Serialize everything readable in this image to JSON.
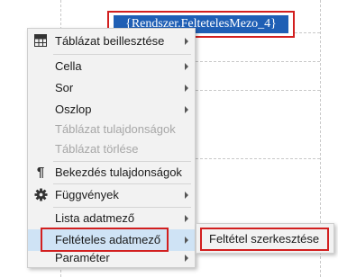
{
  "document": {
    "field_text": "{Rendszer.FeltetelesMezo_4}"
  },
  "context_menu": {
    "items": [
      {
        "label": "Táblázat beillesztése",
        "icon": "table-icon",
        "submenu": true,
        "enabled": true
      },
      {
        "label": "Cella",
        "icon": "",
        "submenu": true,
        "enabled": true
      },
      {
        "label": "Sor",
        "icon": "",
        "submenu": true,
        "enabled": true
      },
      {
        "label": "Oszlop",
        "icon": "",
        "submenu": true,
        "enabled": true
      },
      {
        "label": "Táblázat tulajdonságok",
        "icon": "",
        "submenu": false,
        "enabled": false
      },
      {
        "label": "Táblázat törlése",
        "icon": "",
        "submenu": false,
        "enabled": false
      },
      {
        "label": "Bekezdés tulajdonságok",
        "icon": "pilcrow-icon",
        "submenu": false,
        "enabled": true
      },
      {
        "label": "Függvények",
        "icon": "gear-icon",
        "submenu": true,
        "enabled": true
      },
      {
        "label": "Lista adatmező",
        "icon": "",
        "submenu": true,
        "enabled": true
      },
      {
        "label": "Feltételes adatmező",
        "icon": "",
        "submenu": true,
        "enabled": true,
        "highlighted": true
      },
      {
        "label": "Paraméter",
        "icon": "",
        "submenu": true,
        "enabled": true
      }
    ]
  },
  "submenu": {
    "items": [
      {
        "label": "Feltétel szerkesztése"
      }
    ]
  },
  "colors": {
    "highlight_border": "#d21f1f",
    "selected_field_bg": "#1f5fb5",
    "menu_bg": "#f2f2f2",
    "disabled_text": "#a7a7a7"
  }
}
